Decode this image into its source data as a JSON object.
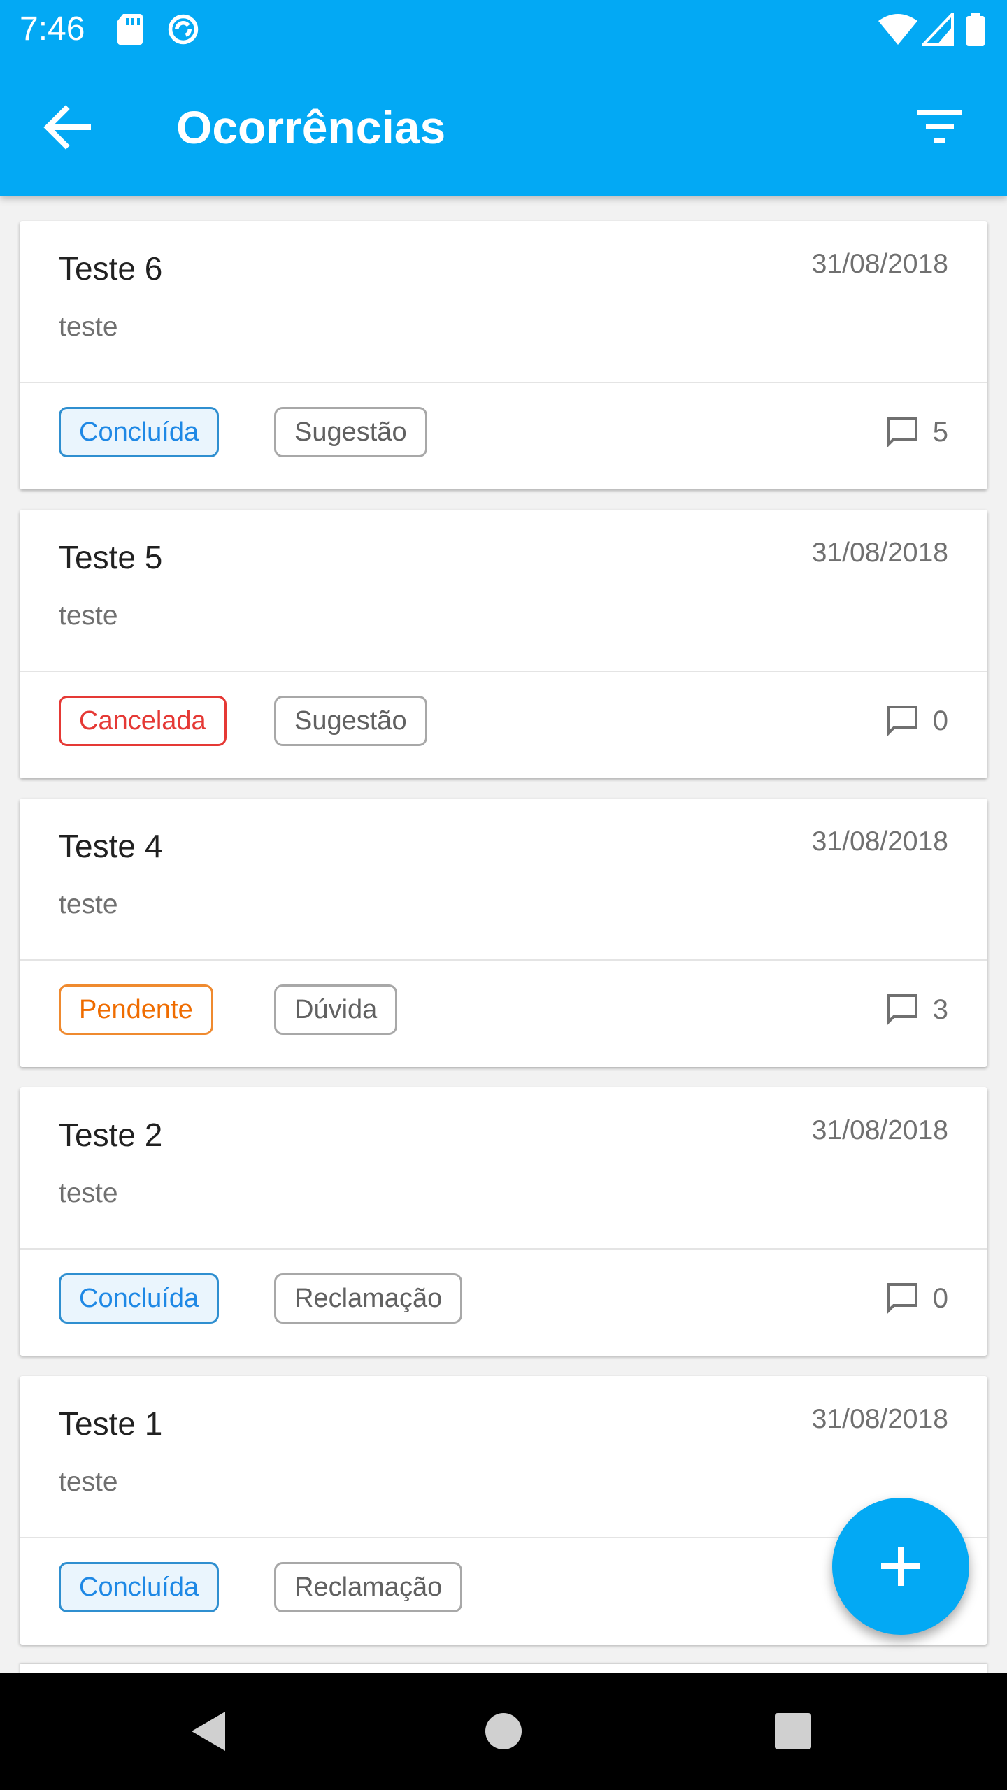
{
  "status_bar": {
    "time": "7:46",
    "left_icons": [
      "sd-card-icon",
      "sync-icon"
    ],
    "right_icons": [
      "wifi-icon",
      "signal-icon",
      "battery-icon"
    ]
  },
  "app_bar": {
    "title": "Ocorrências",
    "back_icon": "arrow-back-icon",
    "filter_icon": "filter-list-icon",
    "color": "#03a9f4"
  },
  "items": [
    {
      "title": "Teste 6",
      "date": "31/08/2018",
      "description": "teste",
      "status": "Concluída",
      "status_key": "concluida",
      "type": "Sugestão",
      "comments": "5"
    },
    {
      "title": "Teste 5",
      "date": "31/08/2018",
      "description": "teste",
      "status": "Cancelada",
      "status_key": "cancelada",
      "type": "Sugestão",
      "comments": "0"
    },
    {
      "title": "Teste 4",
      "date": "31/08/2018",
      "description": "teste",
      "status": "Pendente",
      "status_key": "pendente",
      "type": "Dúvida",
      "comments": "3"
    },
    {
      "title": "Teste 2",
      "date": "31/08/2018",
      "description": "teste",
      "status": "Concluída",
      "status_key": "concluida",
      "type": "Reclamação",
      "comments": "0"
    },
    {
      "title": "Teste 1",
      "date": "31/08/2018",
      "description": "teste",
      "status": "Concluída",
      "status_key": "concluida",
      "type": "Reclamação",
      "comments": ""
    }
  ],
  "status_colors": {
    "concluida": "#1e88e5",
    "cancelada": "#e53935",
    "pendente": "#ef6c00"
  },
  "fab": {
    "icon": "add-icon"
  },
  "nav_bar": {
    "icons": [
      "back-triangle-icon",
      "home-circle-icon",
      "recents-square-icon"
    ]
  }
}
